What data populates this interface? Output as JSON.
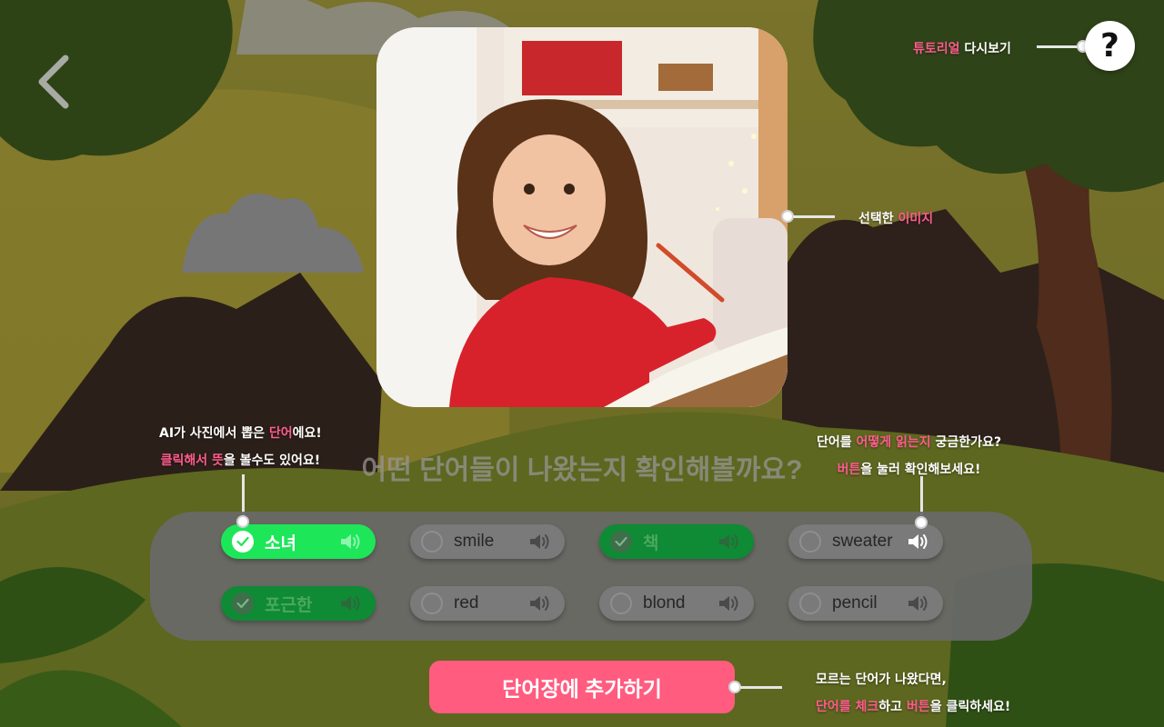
{
  "help": {
    "label_pink": "튜토리얼",
    "label_white": " 다시보기",
    "icon": "question-mark-icon",
    "glyph": "?"
  },
  "image_callout": {
    "white": "선택한 ",
    "pink": "이미지"
  },
  "ai_callout": {
    "line1_white_a": "AI가 사진에서 뽑은 ",
    "line1_pink": "단어",
    "line1_white_b": "에요!",
    "line2_pink_a": "클릭해서 ",
    "line2_pink_b": "뜻",
    "line2_white_a": "을 볼수도 있어요!"
  },
  "pron_callout": {
    "line1_white_a": "단어를 ",
    "line1_pink": "어떻게 읽는지",
    "line1_white_b": " 궁금한가요?",
    "line2_pink": "버튼",
    "line2_white": "을 눌러 확인해보세요!"
  },
  "add_callout": {
    "line1": "모르는 단어가 나왔다면,",
    "line2_pink_a": "단어를 체크",
    "line2_white_a": "하고 ",
    "line2_pink_b": "버튼",
    "line2_white_b": "을 클릭하세요!"
  },
  "question": "어떤 단어들이 나왔는지 확인해볼까요?",
  "words": [
    {
      "label": "소녀",
      "state": "selected-bright"
    },
    {
      "label": "smile",
      "state": "unselected"
    },
    {
      "label": "책",
      "state": "selected-dark"
    },
    {
      "label": "sweater",
      "state": "unselected"
    },
    {
      "label": "포근한",
      "state": "selected-dark"
    },
    {
      "label": "red",
      "state": "unselected"
    },
    {
      "label": "blond",
      "state": "unselected"
    },
    {
      "label": "pencil",
      "state": "unselected"
    }
  ],
  "add_button": "단어장에 추가하기",
  "colors": {
    "accent_pink": "#ff5c80",
    "selected_green": "#1ee659",
    "selected_dark_green": "#0f8a35"
  }
}
